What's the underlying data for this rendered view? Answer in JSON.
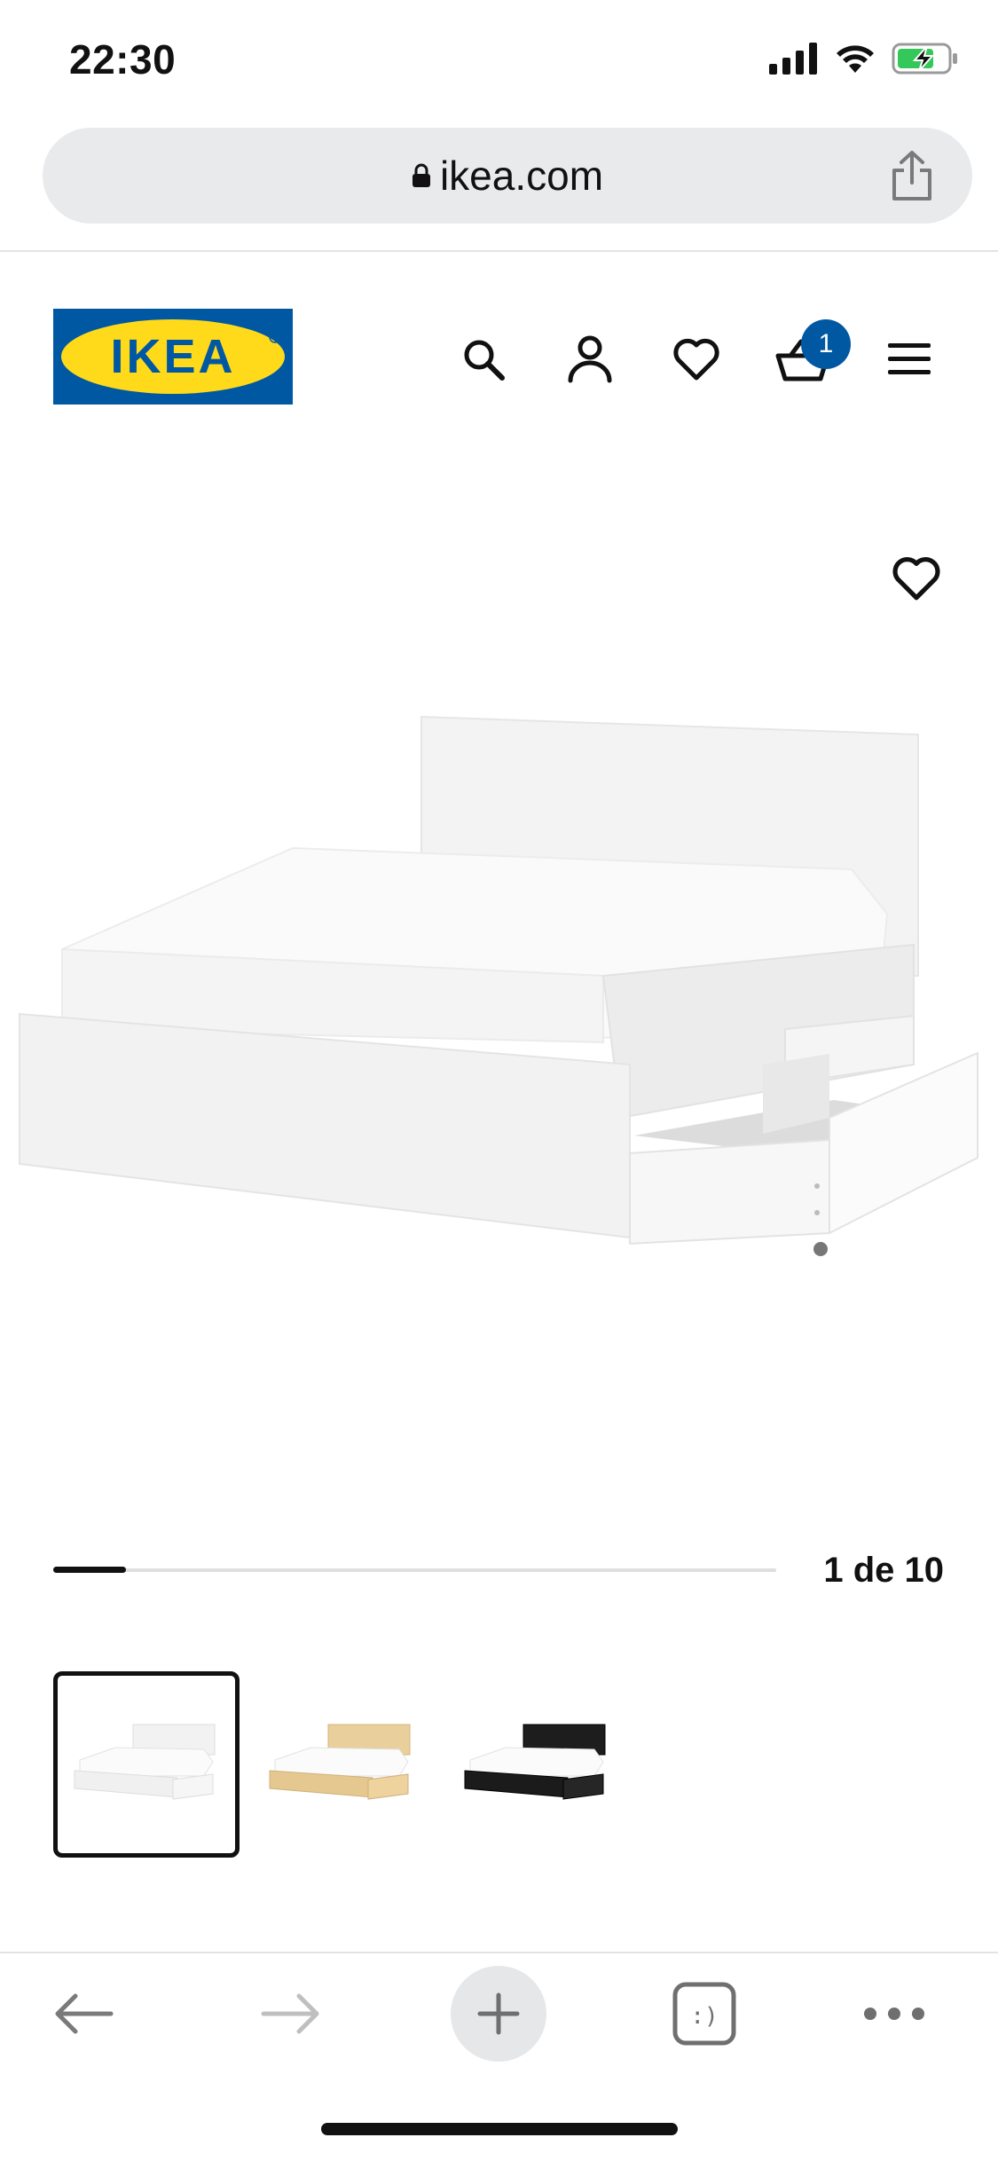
{
  "status_bar": {
    "time": "22:30"
  },
  "browser": {
    "url": "ikea.com",
    "share_label": "Share"
  },
  "header": {
    "logo_text": "IKEA",
    "cart_count": "1",
    "colors": {
      "brand_blue": "#0058a3",
      "brand_yellow": "#ffda1a"
    }
  },
  "gallery": {
    "position_text": "1 de 10",
    "current_index": 1,
    "total": 10,
    "thumbnails": [
      {
        "variant": "white",
        "selected": true
      },
      {
        "variant": "white stained oak veneer",
        "selected": false
      },
      {
        "variant": "black-brown",
        "selected": false
      }
    ]
  },
  "toolbar": {
    "tabs_label": ":)"
  }
}
